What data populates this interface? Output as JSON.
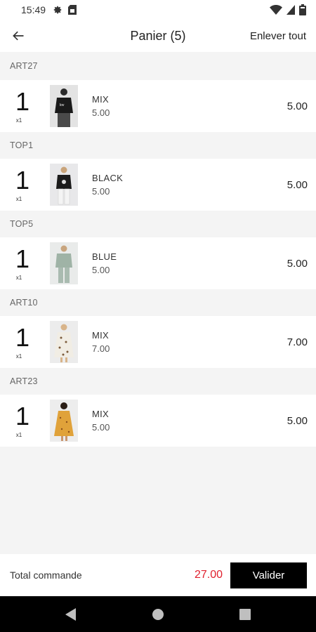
{
  "status_bar": {
    "time": "15:49",
    "icons": [
      "settings-icon",
      "sim-card-icon",
      "wifi-icon",
      "signal-icon",
      "battery-icon"
    ]
  },
  "app_bar": {
    "title": "Panier (5)",
    "clear_all_label": "Enlever tout",
    "back_icon": "arrow-back-icon"
  },
  "cart": {
    "items": [
      {
        "ref": "ART27",
        "qty": "1",
        "qty_sub": "x1",
        "color": "MIX",
        "unit_price": "5.00",
        "total": "5.00"
      },
      {
        "ref": "TOP1",
        "qty": "1",
        "qty_sub": "x1",
        "color": "BLACK",
        "unit_price": "5.00",
        "total": "5.00"
      },
      {
        "ref": "TOP5",
        "qty": "1",
        "qty_sub": "x1",
        "color": "BLUE",
        "unit_price": "5.00",
        "total": "5.00"
      },
      {
        "ref": "ART10",
        "qty": "1",
        "qty_sub": "x1",
        "color": "MIX",
        "unit_price": "7.00",
        "total": "7.00"
      },
      {
        "ref": "ART23",
        "qty": "1",
        "qty_sub": "x1",
        "color": "MIX",
        "unit_price": "5.00",
        "total": "5.00"
      }
    ]
  },
  "footer": {
    "total_label": "Total commande",
    "total_value": "27.00",
    "validate_label": "Valider"
  },
  "nav_bar": {
    "icons": [
      "nav-back-icon",
      "nav-home-icon",
      "nav-recents-icon"
    ]
  },
  "colors": {
    "accent_total": "#e0202e",
    "button_bg": "#000000",
    "page_bg": "#f4f4f4"
  }
}
